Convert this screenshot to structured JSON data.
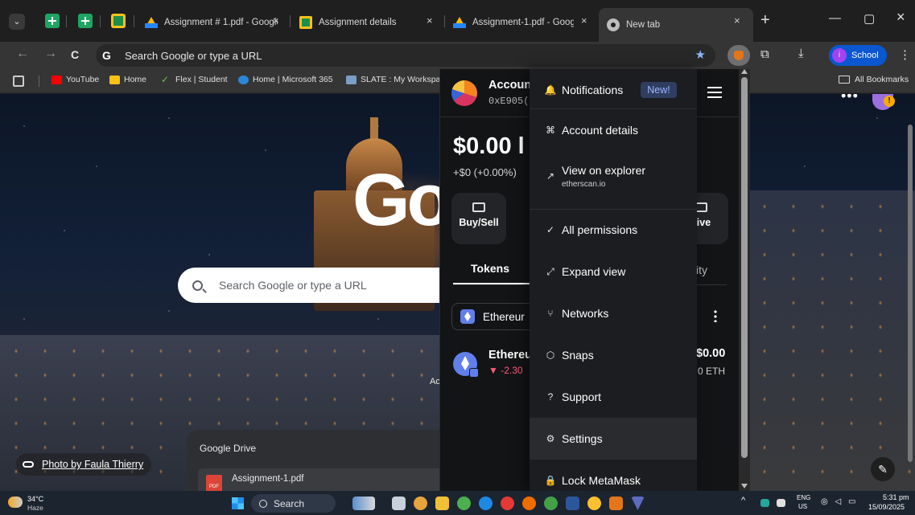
{
  "tabs": [
    {
      "title": "Assignment # 1.pdf - Google",
      "close": "×",
      "favicon": "drive-icon"
    },
    {
      "title": "Assignment details",
      "close": "×",
      "favicon": "classroom-icon"
    },
    {
      "title": "Assignment-1.pdf - Google",
      "close": "×",
      "favicon": "drive-icon"
    },
    {
      "title": "New tab",
      "close": "×",
      "favicon": "chrome-icon"
    }
  ],
  "window": {
    "new_tab": "+",
    "minimize": "—",
    "maximize": "▢",
    "close": "×"
  },
  "toolbar": {
    "back": "←",
    "forward": "→",
    "reload": "C",
    "omnibox_text": "Search Google or type a URL",
    "google_g": "G",
    "profile_label": "School",
    "profile_initial": "i",
    "star": "★",
    "extensions": "⧉",
    "download": "⤓",
    "menu": "⋮"
  },
  "bookmarks": {
    "items": [
      "YouTube",
      "Home",
      "Flex | Student",
      "Home | Microsoft 365",
      "SLATE : My Workspac"
    ],
    "all_bookmarks": "All Bookmarks"
  },
  "ntp": {
    "logo": "Go",
    "search_placeholder": "Search Google or type a URL",
    "ad_label": "Ac",
    "drive_title": "Google Drive",
    "drive_file": "Assignment-1.pdf",
    "pdf_label": "PDF",
    "photo_credit": "Photo by Faula Thierry",
    "dots": "•••",
    "warning": "!",
    "edit": "✎"
  },
  "metamask": {
    "account_name": "Accoun",
    "address": "0xE905(",
    "balance": "$0.00 l",
    "change": "+$0 (+0.00%)",
    "actions": [
      {
        "label": "Buy/Sell"
      },
      {
        "label": "eive"
      }
    ],
    "tab_tokens": "Tokens",
    "tab_activity": "ity",
    "network": "Ethereur",
    "token_name": "Ethereu",
    "token_change": "▼ -2.30",
    "token_value": "$0.00",
    "token_amount": "0 ETH",
    "menu": [
      {
        "label": "Notifications",
        "icon": "🔔",
        "badge": "New!"
      },
      {
        "label": "Account details",
        "icon": "⌘"
      },
      {
        "label": "View on explorer",
        "icon": "↗",
        "sub": "etherscan.io"
      },
      {
        "label": "All permissions",
        "icon": "✓"
      },
      {
        "label": "Expand view",
        "icon": "⤢"
      },
      {
        "label": "Networks",
        "icon": "⑂"
      },
      {
        "label": "Snaps",
        "icon": "⬡"
      },
      {
        "label": "Support",
        "icon": "?"
      },
      {
        "label": "Settings",
        "icon": "⚙"
      },
      {
        "label": "Lock MetaMask",
        "icon": "🔒"
      }
    ]
  },
  "taskbar": {
    "temperature": "34°C",
    "condition": "Haze",
    "search": "Search",
    "lang": "ENG",
    "region": "US",
    "time": "5:31 pm",
    "date": "15/09/2025",
    "tray_chevron": "^",
    "tray_sys": "◎ ◁ ▭"
  },
  "colors": {
    "metamask_bg": "#131416",
    "menu_bg": "#1c1d20",
    "accent_blue": "#0b57d0",
    "negative": "#ff5c7a",
    "new_badge": "#9db5ff"
  }
}
